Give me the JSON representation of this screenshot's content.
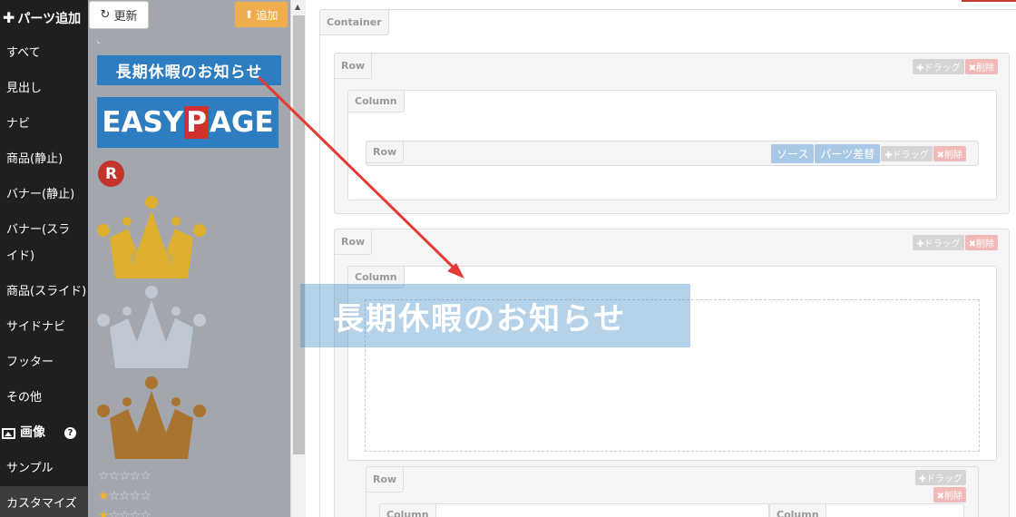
{
  "sidebar": {
    "header": "パーツ追加",
    "items": [
      {
        "label": "すべて"
      },
      {
        "label": "見出し"
      },
      {
        "label": "ナビ"
      },
      {
        "label": "商品(静止)"
      },
      {
        "label": "バナー(静止)"
      },
      {
        "label": "バナー(スライド)"
      },
      {
        "label": "商品(スライド)"
      },
      {
        "label": "サイドナビ"
      },
      {
        "label": "フッター"
      },
      {
        "label": "その他"
      }
    ],
    "image_label": "画像",
    "help": "?",
    "sample": "サンプル",
    "customize": "カスタマイズ"
  },
  "palette": {
    "refresh_label": "更新",
    "refresh_icon": "↻",
    "add_label": "追加",
    "add_icon": "⬆",
    "banner_text": "長期休暇のお知らせ",
    "logo_text_left": "EASY",
    "logo_text_mid": "P",
    "logo_text_right": "AGE",
    "badge_text": "R",
    "stars": "☆☆☆☆☆",
    "star_on": "★",
    "stars_rest": "☆☆☆☆"
  },
  "canvas": {
    "container_label": "Container",
    "row_label": "Row",
    "column_label": "Column",
    "drag_label": "✚ドラッグ",
    "delete_label": "✖削除",
    "source_label": "ソース",
    "swap_label": "パーツ差替",
    "ghost_text": "長期休暇のお知らせ"
  },
  "colors": {
    "banner_blue": "#2e7dc1",
    "add_orange": "#f0ad4e",
    "gold": "#dcb02e",
    "silver": "#c0c9d3",
    "bronze": "#a8742f",
    "arrow_red": "#e53935"
  }
}
